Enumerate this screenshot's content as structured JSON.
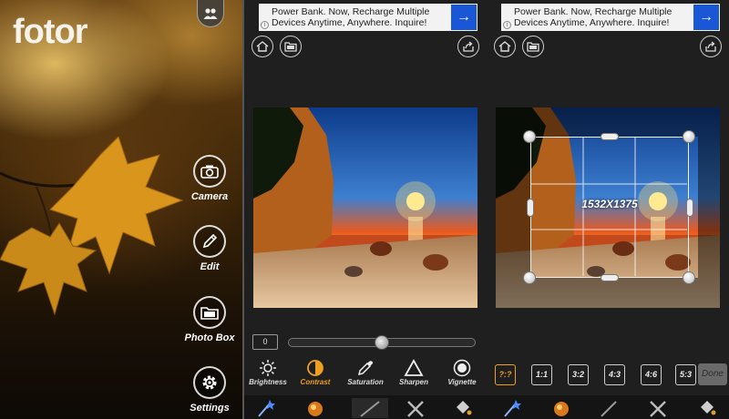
{
  "home": {
    "logo": "fotor",
    "menu": [
      {
        "label": "Camera",
        "icon": "camera-icon"
      },
      {
        "label": "Edit",
        "icon": "pencil-icon"
      },
      {
        "label": "Photo Box",
        "icon": "folder-icon"
      },
      {
        "label": "Settings",
        "icon": "gear-icon"
      }
    ],
    "people_icon": "people-icon"
  },
  "ad": {
    "text": "Power Bank. Now, Recharge Multiple Devices Anytime, Anywhere. Inquire!",
    "arrow": "→",
    "info": "i"
  },
  "adjust": {
    "value": "0",
    "slider_fraction": 0.5,
    "tools": [
      {
        "label": "Brightness",
        "icon": "sun-icon",
        "active": false
      },
      {
        "label": "Contrast",
        "icon": "contrast-icon",
        "active": true
      },
      {
        "label": "Saturation",
        "icon": "dropper-icon",
        "active": false
      },
      {
        "label": "Sharpen",
        "icon": "triangle-icon",
        "active": false
      },
      {
        "label": "Vignette",
        "icon": "vignette-icon",
        "active": false
      }
    ]
  },
  "crop": {
    "dimensions": "1532X1375",
    "ratios": [
      {
        "label": "?:?",
        "active": true
      },
      {
        "label": "1:1",
        "active": false
      },
      {
        "label": "3:2",
        "active": false
      },
      {
        "label": "4:3",
        "active": false
      },
      {
        "label": "4:6",
        "active": false
      },
      {
        "label": "5:3",
        "active": false
      }
    ],
    "done_label": "Done"
  },
  "colors": {
    "accent": "#f0a020",
    "ad_button": "#1a57d6",
    "panel_bg": "#1f1f1f"
  }
}
